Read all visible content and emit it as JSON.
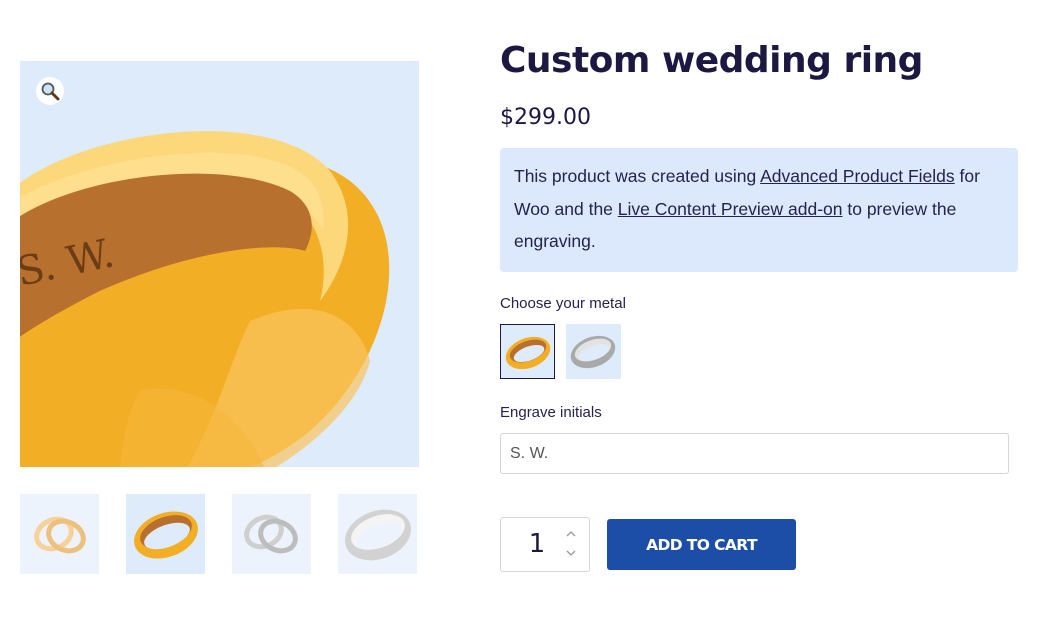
{
  "product": {
    "title": "Custom wedding ring",
    "price": "$299.00"
  },
  "notice": {
    "text_before": "This product was created using ",
    "link1": "Advanced Product Fields",
    "text_middle": " for Woo and the ",
    "link2": "Live Content Preview add-on",
    "text_after": " to preview the engraving."
  },
  "main_image": {
    "engraving_text": "S. W."
  },
  "gallery": {
    "thumbnails": [
      "gold-rings-pair",
      "gold-ring",
      "silver-rings-pair",
      "silver-ring"
    ],
    "active_index": 1
  },
  "metal": {
    "label": "Choose your metal",
    "options": [
      "gold",
      "silver"
    ],
    "selected": "gold"
  },
  "engrave": {
    "label": "Engrave initials",
    "value": "S. W."
  },
  "cart": {
    "quantity": "1",
    "button_label": "ADD TO CART"
  },
  "colors": {
    "accent": "#1c4ea8",
    "title": "#1c1842",
    "notice_bg": "#dce8fb",
    "image_bg": "#deebfb",
    "gold": "#f2ae25",
    "silver": "#c9c9c9"
  },
  "icons": {
    "zoom": "magnifier-icon",
    "qty_up": "chevron-up-icon",
    "qty_down": "chevron-down-icon"
  }
}
